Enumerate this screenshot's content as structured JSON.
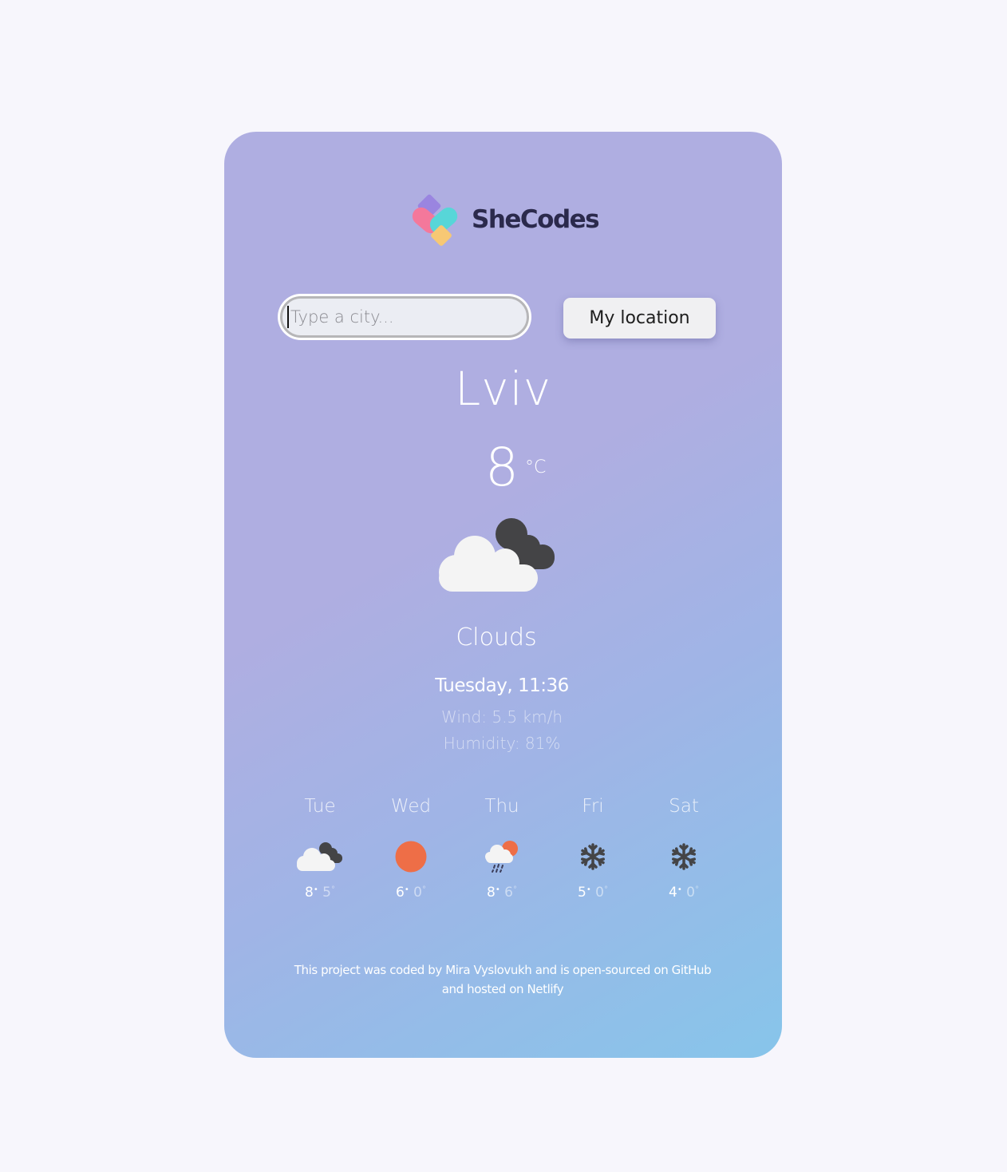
{
  "brand": {
    "name": "SheCodes",
    "icon": "shecodes-logo-icon"
  },
  "search": {
    "placeholder": "Type a city...",
    "value": ""
  },
  "buttons": {
    "my_location": "My location"
  },
  "current": {
    "city": "Lviv",
    "temperature": "8",
    "unit": "°C",
    "icon": "broken-clouds-icon",
    "description": "Clouds",
    "datetime": "Tuesday, 11:36",
    "wind": "Wind: 5.5 km/h",
    "humidity": "Humidity: 81%"
  },
  "forecast": [
    {
      "day": "Tue",
      "icon": "broken-clouds-icon",
      "max": "8",
      "min": "5"
    },
    {
      "day": "Wed",
      "icon": "sun-icon",
      "max": "6",
      "min": "0"
    },
    {
      "day": "Thu",
      "icon": "rain-icon",
      "max": "8",
      "min": "6"
    },
    {
      "day": "Fri",
      "icon": "snow-icon",
      "max": "5",
      "min": "0"
    },
    {
      "day": "Sat",
      "icon": "snow-icon",
      "max": "4",
      "min": "0"
    }
  ],
  "footer": {
    "t1": "This project was coded by ",
    "author": "Mira Vyslovukh",
    "t2": " and is ",
    "source_link": "open-sourced on GitHub",
    "t3": "and hosted on ",
    "host_link": "Netlify"
  },
  "colors": {
    "page_bg": "#f7f6fc",
    "card_gradient_start": "#afaee1",
    "card_gradient_end": "#87c5ea",
    "sun": "#ee6e47",
    "dark_cloud": "#444446"
  }
}
